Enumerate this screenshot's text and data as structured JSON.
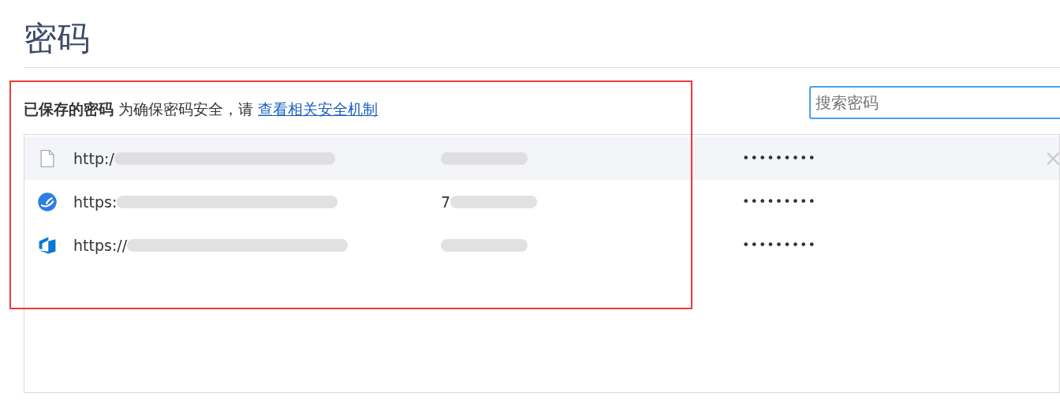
{
  "page_title": "密码",
  "section": {
    "heading": "已保存的密码",
    "note": "为确保密码安全，请",
    "link": "查看相关安全机制"
  },
  "search": {
    "placeholder": "搜索密码"
  },
  "passwords": [
    {
      "kind": "file",
      "site": "http:/",
      "password": "•••••••••",
      "highlighted": true,
      "remove": "×"
    },
    {
      "kind": "globe",
      "site": "https:",
      "username": "7",
      "password": "•••••••••",
      "highlighted": false
    },
    {
      "kind": "azure",
      "site": "https://",
      "password": "•••••••••",
      "highlighted": false
    }
  ],
  "annotation": {
    "kind": "red-box"
  }
}
